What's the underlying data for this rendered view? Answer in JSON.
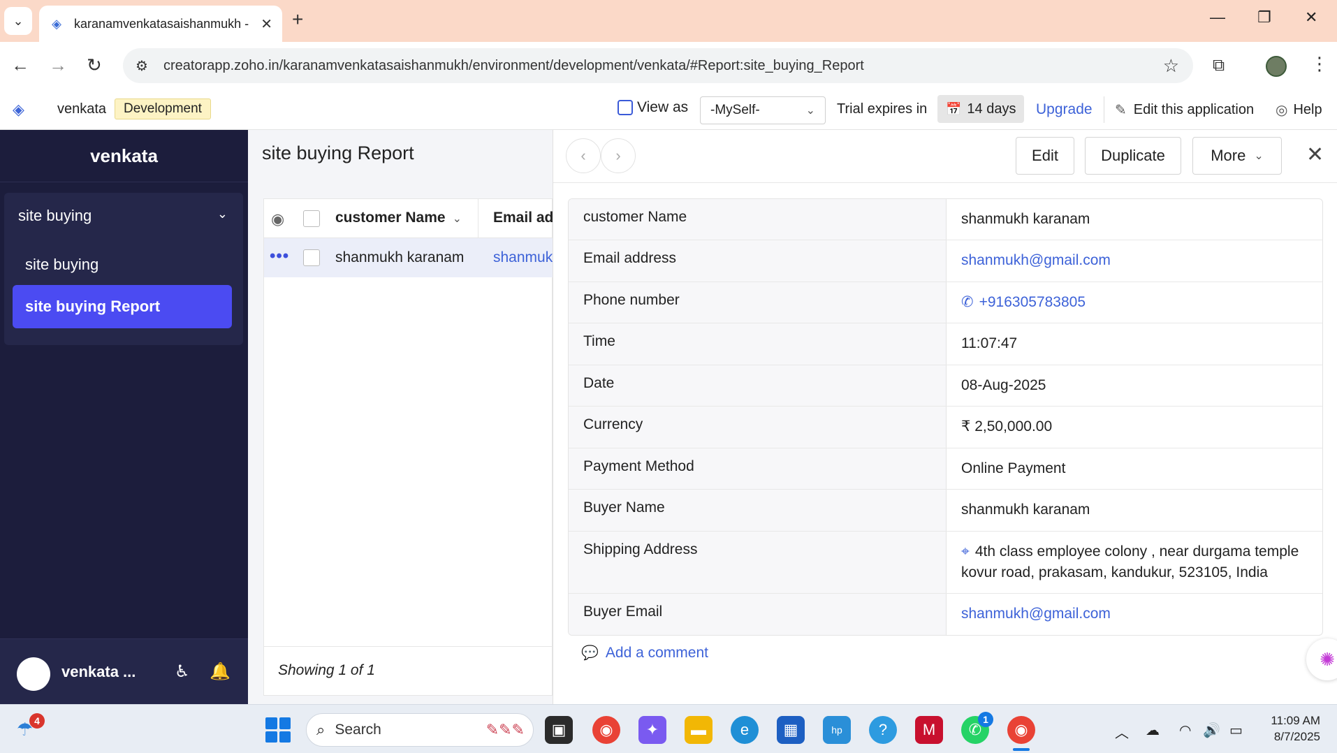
{
  "browser": {
    "tab_title": "karanamvenkatasaishanmukh - ",
    "url": "creatorapp.zoho.in/karanamvenkatasaishanmukh/environment/development/venkata/#Report:site_buying_Report"
  },
  "app_header": {
    "app_name": "venkata",
    "environment": "Development",
    "view_as": "View as",
    "view_as_value": "-MySelf-",
    "trial_text": "Trial expires in",
    "trial_days": "14 days",
    "upgrade": "Upgrade",
    "edit_app": "Edit this application",
    "help": "Help"
  },
  "sidebar": {
    "title": "venkata",
    "group": "site buying",
    "items": [
      {
        "label": "site buying",
        "active": false
      },
      {
        "label": "site buying Report",
        "active": true
      }
    ],
    "user": "venkata ..."
  },
  "report": {
    "title": "site buying Report",
    "columns": [
      "customer Name",
      "Email ad"
    ],
    "rows": [
      {
        "customer_name": "shanmukh karanam",
        "email": "shanmuk"
      }
    ],
    "footer": "Showing 1 of 1"
  },
  "detail": {
    "buttons": {
      "edit": "Edit",
      "duplicate": "Duplicate",
      "more": "More"
    },
    "fields": [
      {
        "label": "customer Name",
        "value": "shanmukh karanam"
      },
      {
        "label": "Email address",
        "value": "shanmukh@gmail.com"
      },
      {
        "label": "Phone number",
        "value": "+916305783805"
      },
      {
        "label": "Time",
        "value": "11:07:47"
      },
      {
        "label": "Date",
        "value": "08-Aug-2025"
      },
      {
        "label": "Currency",
        "value": "₹ 2,50,000.00"
      },
      {
        "label": "Payment Method",
        "value": "Online Payment"
      },
      {
        "label": "Buyer Name",
        "value": "shanmukh karanam"
      },
      {
        "label": "Shipping Address",
        "value_line1": "4th class employee colony , near durgama temple",
        "value_line2": "kovur road, prakasam, kandukur, 523105, India"
      },
      {
        "label": "Buyer Email",
        "value": "shanmukh@gmail.com"
      }
    ],
    "add_comment": "Add a comment"
  },
  "taskbar": {
    "weather_badge": "4",
    "search_placeholder": "Search",
    "whatsapp_badge": "1",
    "time": "11:09 AM",
    "date": "8/7/2025"
  },
  "colors": {
    "sidebar_bg": "#1c1d3c",
    "active_item": "#4b4bf2",
    "link": "#3d62d8",
    "tabbar": "#fbd9c8"
  }
}
